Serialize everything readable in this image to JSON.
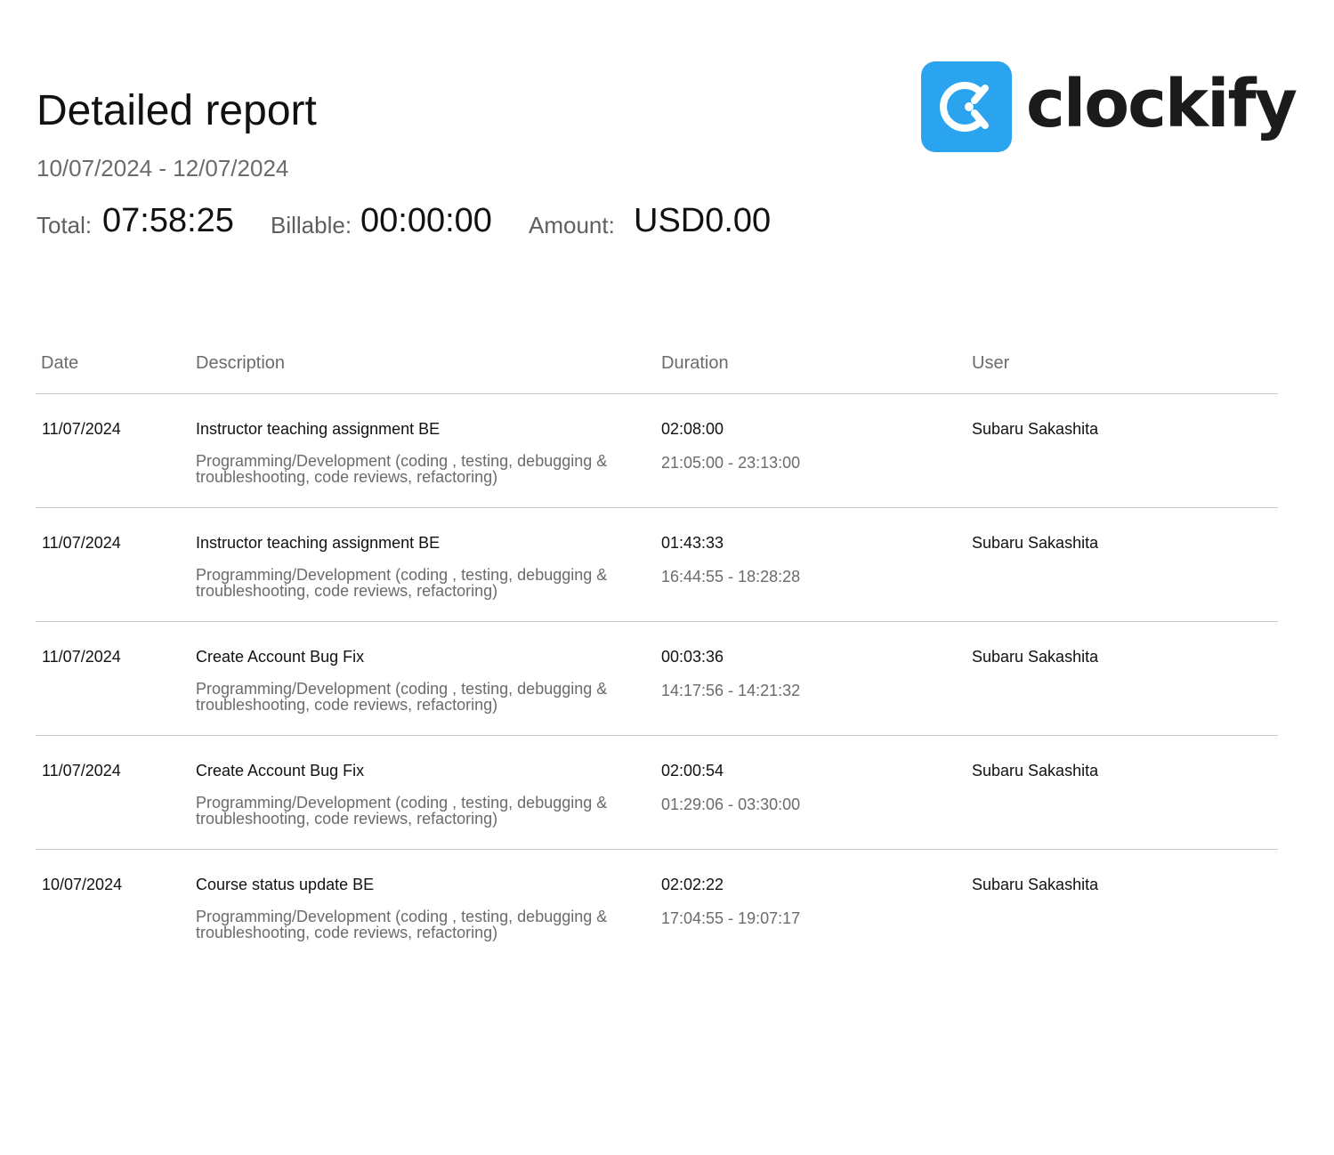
{
  "report": {
    "title": "Detailed report",
    "date_range": "10/07/2024 - 12/07/2024"
  },
  "totals": {
    "total_label": "Total:",
    "total_value": "07:58:25",
    "billable_label": "Billable:",
    "billable_value": "00:00:00",
    "amount_label": "Amount:",
    "amount_value": "USD0.00"
  },
  "logo": {
    "wordmark": "clockify",
    "icon": "clockify-logo-icon",
    "brand_color": "#2aa4ee"
  },
  "table": {
    "headers": {
      "date": "Date",
      "description": "Description",
      "duration": "Duration",
      "user": "User"
    },
    "rows": [
      {
        "date": "11/07/2024",
        "description": "Instructor teaching assignment BE",
        "project": "Programming/Development (coding , testing, debugging & troubleshooting, code reviews, refactoring)",
        "duration": "02:08:00",
        "time_range": "21:05:00 - 23:13:00",
        "user": "Subaru Sakashita"
      },
      {
        "date": "11/07/2024",
        "description": "Instructor teaching assignment BE",
        "project": "Programming/Development (coding , testing, debugging & troubleshooting, code reviews, refactoring)",
        "duration": "01:43:33",
        "time_range": "16:44:55 - 18:28:28",
        "user": "Subaru Sakashita"
      },
      {
        "date": "11/07/2024",
        "description": "Create Account Bug Fix",
        "project": "Programming/Development (coding , testing, debugging & troubleshooting, code reviews, refactoring)",
        "duration": "00:03:36",
        "time_range": "14:17:56 - 14:21:32",
        "user": "Subaru Sakashita"
      },
      {
        "date": "11/07/2024",
        "description": "Create Account Bug Fix",
        "project": "Programming/Development (coding , testing, debugging & troubleshooting, code reviews, refactoring)",
        "duration": "02:00:54",
        "time_range": "01:29:06 - 03:30:00",
        "user": "Subaru Sakashita"
      },
      {
        "date": "10/07/2024",
        "description": "Course status update BE",
        "project": "Programming/Development (coding , testing, debugging & troubleshooting, code reviews, refactoring)",
        "duration": "02:02:22",
        "time_range": "17:04:55 - 19:07:17",
        "user": "Subaru Sakashita"
      }
    ]
  }
}
